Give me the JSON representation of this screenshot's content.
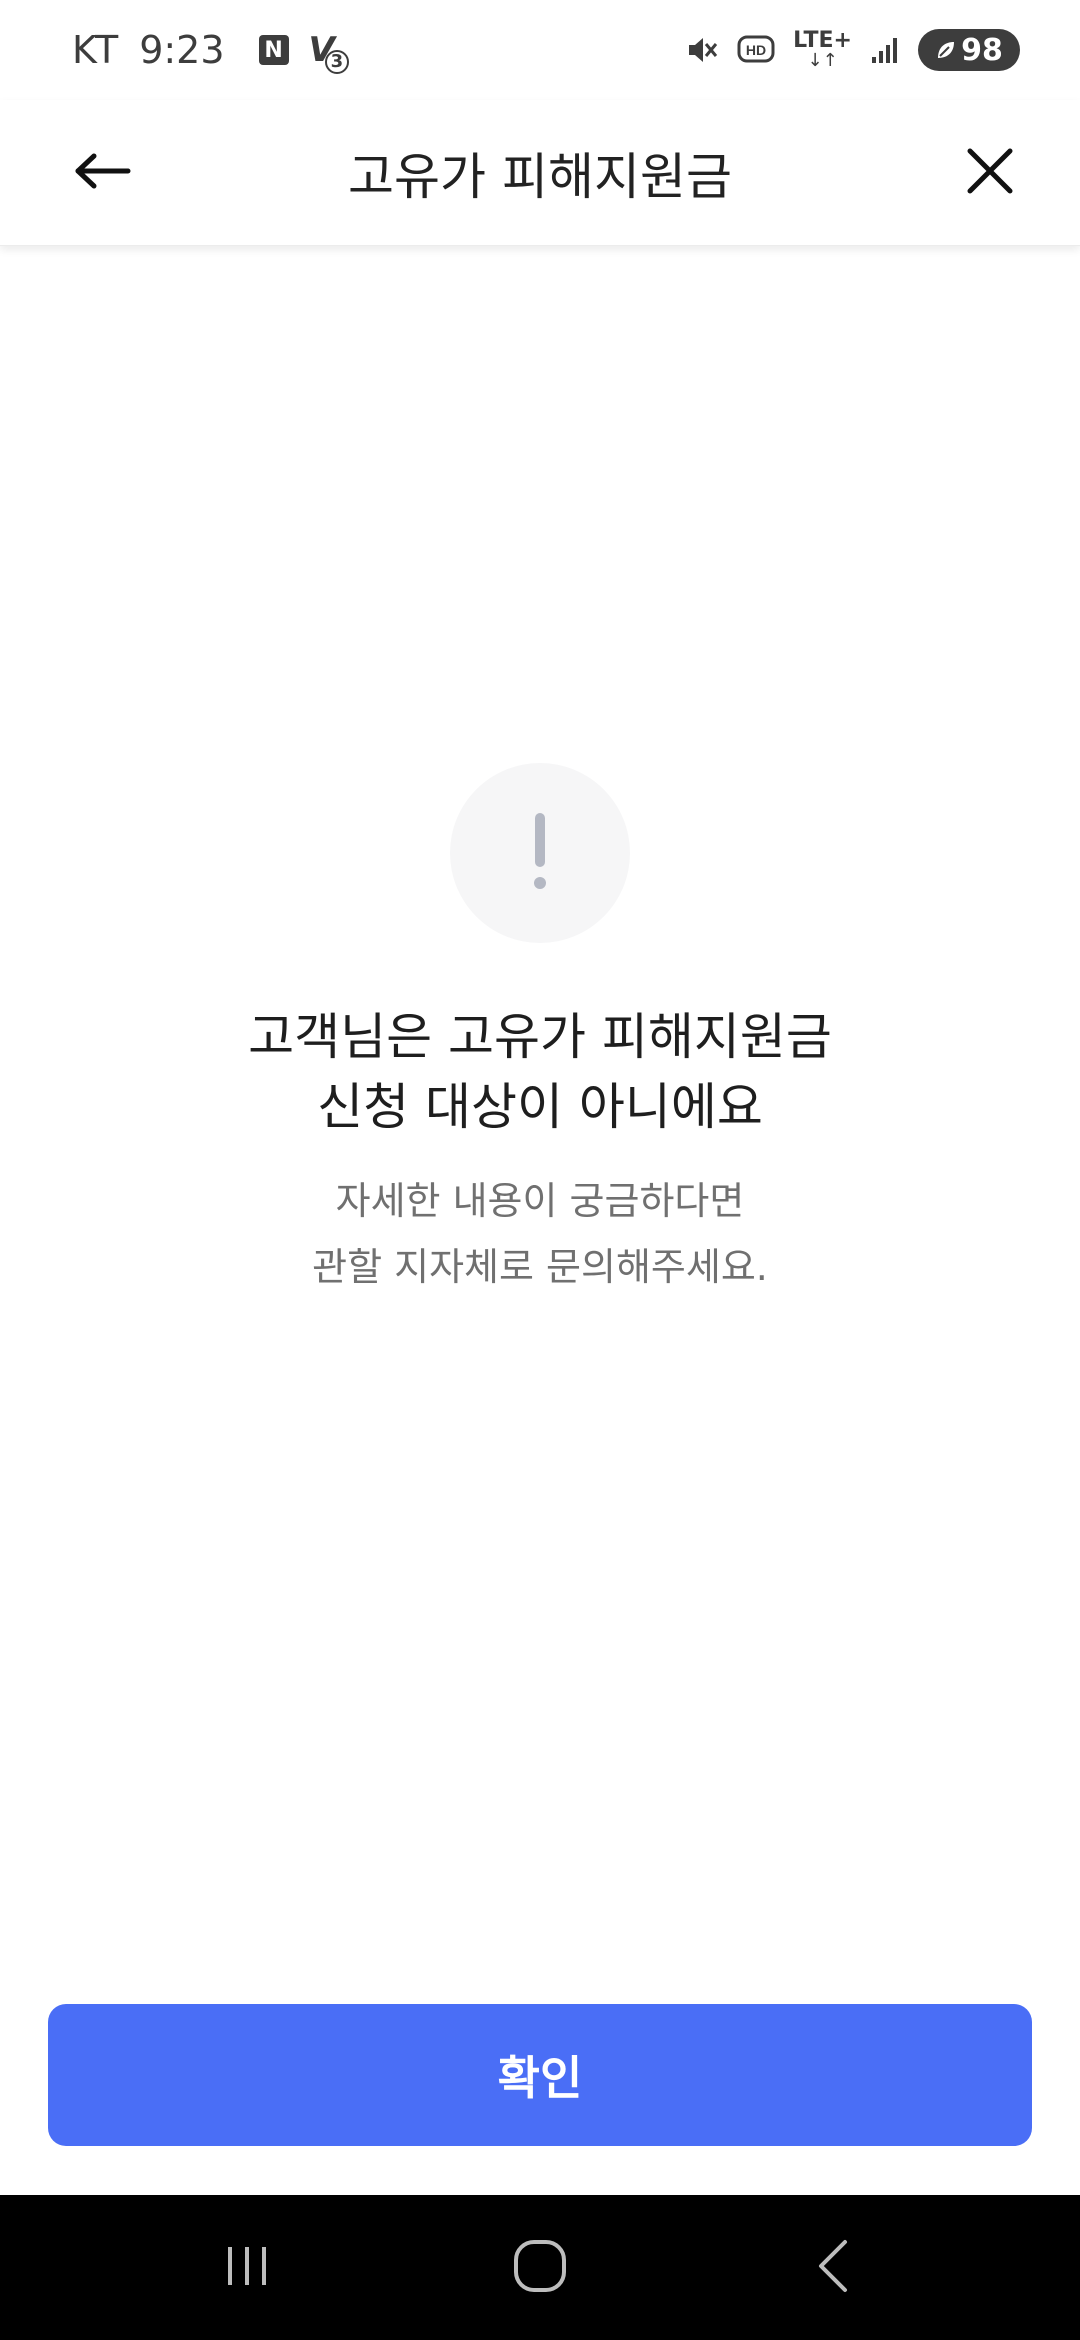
{
  "status_bar": {
    "carrier": "KT",
    "time": "9:23",
    "notif_n": "N",
    "notif_v": "V",
    "notif_v_sub": "3",
    "lte": "LTE+",
    "battery": "98"
  },
  "header": {
    "title": "고유가 피해지원금"
  },
  "content": {
    "headline_line1": "고객님은 고유가 피해지원금",
    "headline_line2": "신청 대상이 아니에요",
    "sub_line1": "자세한 내용이 궁금하다면",
    "sub_line2": "관할 지자체로 문의해주세요."
  },
  "footer": {
    "confirm_label": "확인"
  },
  "colors": {
    "accent": "#4a6ef6",
    "alert_icon": "#b4b8c3",
    "alert_bg": "#f6f6f7"
  },
  "icons": {
    "back": "arrow-left-icon",
    "close": "close-icon",
    "alert": "exclamation-icon",
    "nav_recent": "recent-apps-icon",
    "nav_home": "home-icon",
    "nav_back": "chevron-left-icon"
  }
}
